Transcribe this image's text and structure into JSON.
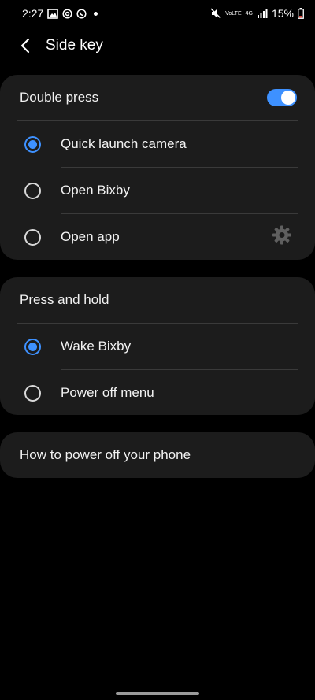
{
  "status_bar": {
    "time": "2:27",
    "network_top": "VoLTE",
    "network_label": "4G",
    "battery": "15%"
  },
  "header": {
    "title": "Side key"
  },
  "double_press": {
    "title": "Double press",
    "toggle_on": true,
    "options": [
      {
        "label": "Quick launch camera",
        "selected": true
      },
      {
        "label": "Open Bixby",
        "selected": false
      },
      {
        "label": "Open app",
        "selected": false
      }
    ]
  },
  "press_and_hold": {
    "title": "Press and hold",
    "options": [
      {
        "label": "Wake Bixby",
        "selected": true
      },
      {
        "label": "Power off menu",
        "selected": false
      }
    ]
  },
  "help": {
    "label": "How to power off your phone"
  },
  "colors": {
    "accent": "#3e91ff",
    "card": "#1c1c1c",
    "background": "#000000"
  }
}
